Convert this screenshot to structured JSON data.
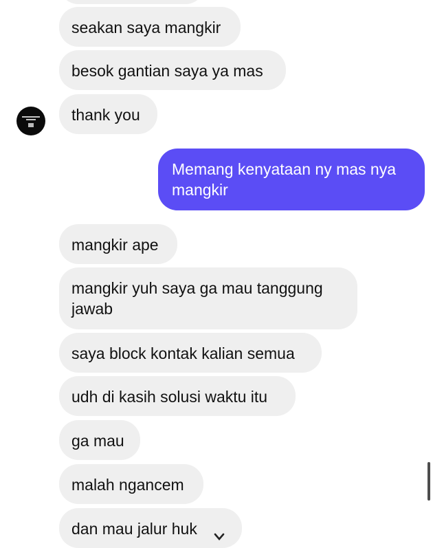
{
  "messages": [
    {
      "sender": "other",
      "text": "seakan saya mangkir"
    },
    {
      "sender": "other",
      "text": "besok gantian saya ya mas"
    },
    {
      "sender": "other",
      "text": "thank you"
    },
    {
      "sender": "me",
      "text": "Memang kenyataan ny mas nya mangkir"
    },
    {
      "sender": "other",
      "text": "mangkir ape"
    },
    {
      "sender": "other",
      "text": "mangkir yuh saya ga mau tanggung jawab"
    },
    {
      "sender": "other",
      "text": "saya block kontak kalian semua"
    },
    {
      "sender": "other",
      "text": "udh di kasih solusi waktu itu"
    },
    {
      "sender": "other",
      "text": "ga mau"
    },
    {
      "sender": "other",
      "text": "malah ngancem"
    },
    {
      "sender": "other",
      "text": "dan mau jalur huk"
    }
  ],
  "colors": {
    "incoming_bubble": "#efefef",
    "outgoing_bubble": "#5b4df5",
    "background": "#ffffff"
  },
  "icons": {
    "avatar": "profile-avatar",
    "scroll_down": "chevron-down-icon"
  }
}
